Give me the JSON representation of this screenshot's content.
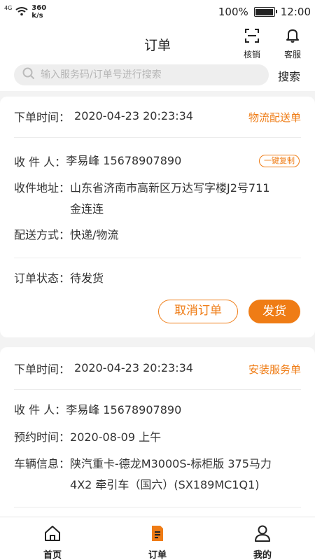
{
  "status_bar": {
    "signal": "4G",
    "speed_value": "360",
    "speed_unit": "k/s",
    "battery": "100%",
    "time": "12:00"
  },
  "header": {
    "title": "订单",
    "scan_label": "核销",
    "service_label": "客服"
  },
  "search": {
    "placeholder": "输入服务码/订单号进行搜索",
    "button_label": "搜索"
  },
  "orders": [
    {
      "time_label": "下单时间：",
      "time_value": "2020-04-23  20:23:34",
      "type": "物流配送单",
      "recipient_label": "收 件 人：",
      "recipient_value": "李易峰   15678907890",
      "copy_label": "一键复制",
      "address_label": "收件地址：",
      "address_value": "山东省济南市高新区万达写字楼J2号711金连连",
      "delivery_label": "配送方式：",
      "delivery_value": "快递/物流",
      "status_label": "订单状态：",
      "status_value": "待发货",
      "cancel_label": "取消订单",
      "ship_label": "发货"
    },
    {
      "time_label": "下单时间：",
      "time_value": "2020-04-23  20:23:34",
      "type": "安装服务单",
      "recipient_label": "收 件 人：",
      "recipient_value": "李易峰   15678907890",
      "appointment_label": "预约时间：",
      "appointment_value": "2020-08-09  上午",
      "vehicle_label": "车辆信息：",
      "vehicle_value": "陕汽重卡-德龙M3000S-标柜版 375马力 4X2 牵引车（国六）(SX189MC1Q1)"
    }
  ],
  "tabbar": {
    "home": "首页",
    "orders": "订单",
    "mine": "我的"
  },
  "colors": {
    "accent": "#ef7c15",
    "text": "#333333",
    "background": "#f3f3f3"
  },
  "icons": [
    "wifi-icon",
    "battery-icon",
    "scan-icon",
    "bell-icon",
    "search-icon",
    "home-icon",
    "order-icon",
    "user-icon"
  ]
}
